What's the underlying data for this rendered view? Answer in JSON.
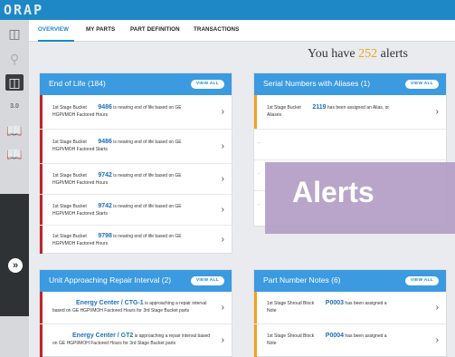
{
  "app": {
    "logo": "ORAP"
  },
  "rail": {
    "icons": [
      "database-icon",
      "search-icon",
      "database-active-icon",
      "3d-icon",
      "book-icon",
      "book-icon",
      "expand-icon"
    ],
    "expand_glyph": "»"
  },
  "tabs": [
    {
      "label": "OVERVIEW"
    },
    {
      "label": "MY PARTS"
    },
    {
      "label": "PART DEFINITION"
    },
    {
      "label": "TRANSACTIONS"
    }
  ],
  "summary": {
    "prefix": "You have ",
    "count": "252",
    "suffix": " alerts"
  },
  "cards": {
    "end_of_life": {
      "title": "End of Life (184)",
      "view_all": "VIEW ALL",
      "rows": [
        {
          "part": "1st Stage Bucket",
          "number": "9486",
          "message": "is nearing end of life based on GE",
          "line2": "HGPI/MOH Factored Hours"
        },
        {
          "part": "1st Stage Bucket",
          "number": "9486",
          "message": "is nearing end of life based on GE",
          "line2": "HGPI/MOH Factored Starts"
        },
        {
          "part": "1st Stage Bucket",
          "number": "9742",
          "message": "is nearing end of life based on GE",
          "line2": "HGPI/MOH Factored Hours"
        },
        {
          "part": "1st Stage Bucket",
          "number": "9742",
          "message": "is nearing end of life based on GE",
          "line2": "HGPI/MOH Factored Starts"
        },
        {
          "part": "1st Stage Bucket",
          "number": "9798",
          "message": "is nearing end of life based on GE",
          "line2": "HGPI/MOH Factored Hours"
        }
      ]
    },
    "serial_aliases": {
      "title": "Serial Numbers with Aliases (1)",
      "view_all": "VIEW ALL",
      "rows": [
        {
          "part": "1st Stage Bucket",
          "number": "2119",
          "message": "has been assigned an Alias, or",
          "line2": "Aliases"
        }
      ],
      "dash": "-"
    },
    "repair_interval": {
      "title": "Unit Approaching Repair Interval (2)",
      "view_all": "VIEW ALL",
      "rows": [
        {
          "number": "Energy Center / CTG-1",
          "message": "is approaching a repair interval",
          "line2": "based on GE HGPI/MOH Factored Hours for 3rd Stage Bucket parts"
        },
        {
          "number": "Energy Center / GT2",
          "message": "is approaching a repair interval based",
          "line2": "on GE HGPI/MOH Factored Hours for 3rd Stage Bucket parts"
        }
      ]
    },
    "part_notes": {
      "title": "Part Number Notes (6)",
      "view_all": "VIEW ALL",
      "rows": [
        {
          "part": "1st Stage Shroud Block",
          "number": "P0003",
          "message": "has been assigned a",
          "line2": "Note"
        },
        {
          "part": "1st Stage Shroud Block",
          "number": "P0004",
          "message": "has been assigned a",
          "line2": "Note"
        }
      ]
    }
  },
  "overlay": {
    "label": "Alerts"
  },
  "colors": {
    "header": "#1e87c6",
    "card_head": "#3b9ae0",
    "alert_red": "#c0242b",
    "alert_orange": "#f2a21b",
    "count": "#f0a21a",
    "overlay": "#b39dc4"
  }
}
